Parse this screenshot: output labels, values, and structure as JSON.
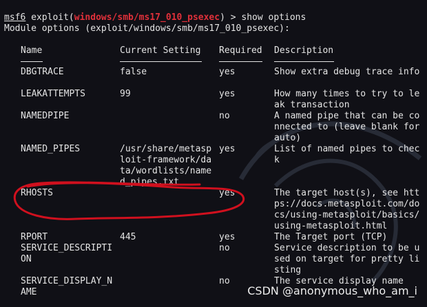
{
  "prompt": {
    "app": "msf6",
    "module_prefix": " exploit(",
    "module": "windows/smb/ms17_010_psexec",
    "suffix": ") > ",
    "command": "show options"
  },
  "section_title": "Module options (exploit/windows/smb/ms17_010_psexec):",
  "headers": {
    "name": "Name",
    "current": "Current Setting",
    "required": "Required",
    "description": "Description"
  },
  "rows": [
    {
      "name": "DBGTRACE",
      "current": "false",
      "required": "yes",
      "description": "Show extra debug trace info"
    },
    {
      "name": "LEAKATTEMPTS",
      "current": "99",
      "required": "yes",
      "description": "How many times to try to leak transaction"
    },
    {
      "name": "NAMEDPIPE",
      "current": "",
      "required": "no",
      "description": "A named pipe that can be connected to (leave blank for auto)"
    },
    {
      "name": "NAMED_PIPES",
      "current": "/usr/share/metasploit-framework/data/wordlists/named_pipes.txt",
      "required": "yes",
      "description": "List of named pipes to check"
    },
    {
      "name": "RHOSTS",
      "current": "",
      "required": "yes",
      "description": "The target host(s), see https://docs.metasploit.com/docs/using-metasploit/basics/using-metasploit.html"
    },
    {
      "name": "RPORT",
      "current": "445",
      "required": "yes",
      "description": "The Target port (TCP)"
    },
    {
      "name": "SERVICE_DESCRIPTION",
      "current": "",
      "required": "no",
      "description": "Service description to be used on target for pretty listing"
    },
    {
      "name": "SERVICE_DISPLAY_NAME",
      "current": "",
      "required": "no",
      "description": "The service display name"
    }
  ],
  "watermark": "CSDN @anonymous_who_am_i",
  "colors": {
    "background": "#101016",
    "text": "#e4e4e4",
    "module_red": "#e0303a",
    "annotation_red": "#d0101e"
  },
  "icons": {
    "background_logo": "kali-dragon-icon"
  }
}
